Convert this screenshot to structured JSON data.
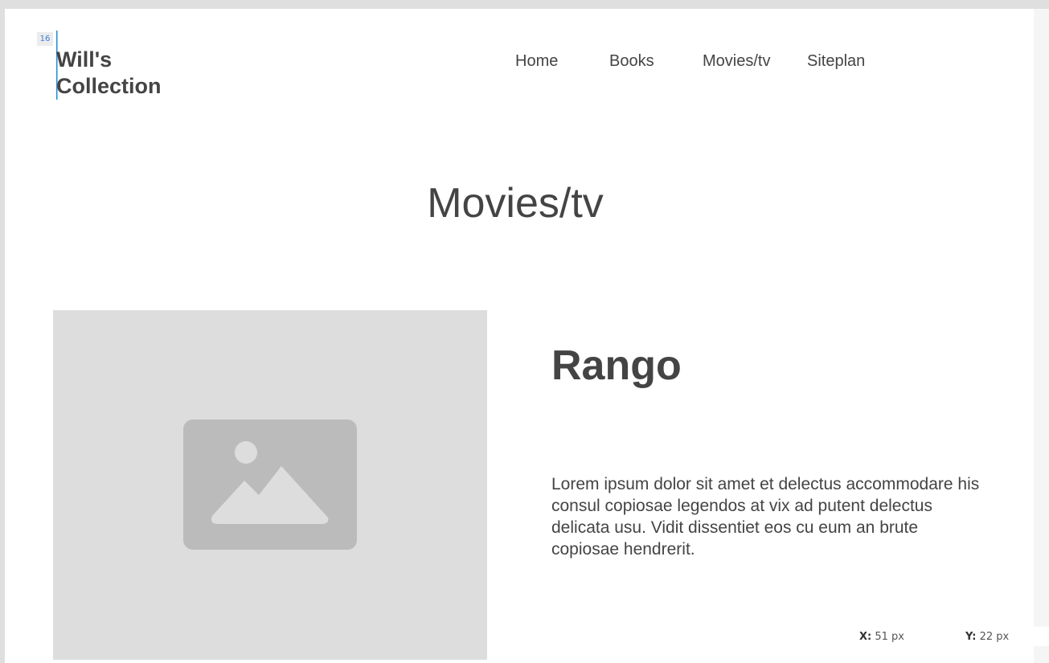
{
  "site": {
    "brand_line1": "Will's",
    "brand_line2": "Collection"
  },
  "nav": {
    "items": [
      {
        "label": "Home"
      },
      {
        "label": "Books"
      },
      {
        "label": "Movies/tv"
      },
      {
        "label": "Siteplan"
      }
    ]
  },
  "page": {
    "title": "Movies/tv"
  },
  "movie": {
    "title": "Rango",
    "description": "Lorem ipsum dolor sit amet et delectus accommodare his consul copiosae legendos at vix ad putent delectus delicata usu. Vidit dissentiet eos cu eum an brute copiosae hendrerit.",
    "image_icon": "image-placeholder-icon"
  },
  "editor": {
    "spacing_badge": "16",
    "x_label": "X:",
    "x_value": "51 px",
    "y_label": "Y:",
    "y_value": "22 px"
  },
  "colors": {
    "text": "#444444",
    "placeholder_bg": "#dddddd",
    "placeholder_icon": "#bbbbbb",
    "guide": "#3b7ddd"
  }
}
